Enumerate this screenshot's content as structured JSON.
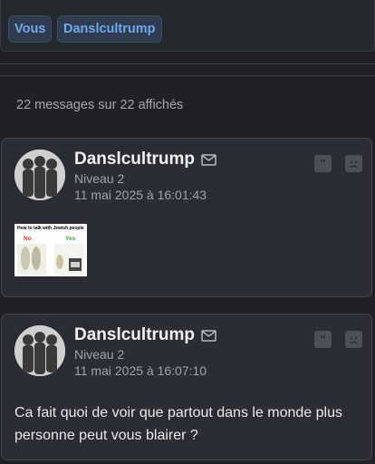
{
  "tabs": [
    {
      "label": "Vous"
    },
    {
      "label": "Danslcultrump"
    }
  ],
  "summary": "22 messages sur 22 affichés",
  "posts": [
    {
      "author": "Danslcultrump",
      "level": "Niveau 2",
      "date": "11 mai 2025 à 16:01:43",
      "attachment": {
        "title": "How to talk with  Jewish people",
        "left_label": "No",
        "right_label": "Yes"
      }
    },
    {
      "author": "Danslcultrump",
      "level": "Niveau 2",
      "date": "11 mai 2025 à 16:07:10",
      "text": "Ca fait quoi de voir que partout dans le monde plus personne peut vous blairer ?"
    }
  ],
  "icons": {
    "mail": "mail-icon",
    "quote": "quote-icon",
    "report": "sad-face-icon"
  },
  "colors": {
    "background": "#1f2125",
    "card": "#2a2d33",
    "accent": "#6fa9ea"
  }
}
